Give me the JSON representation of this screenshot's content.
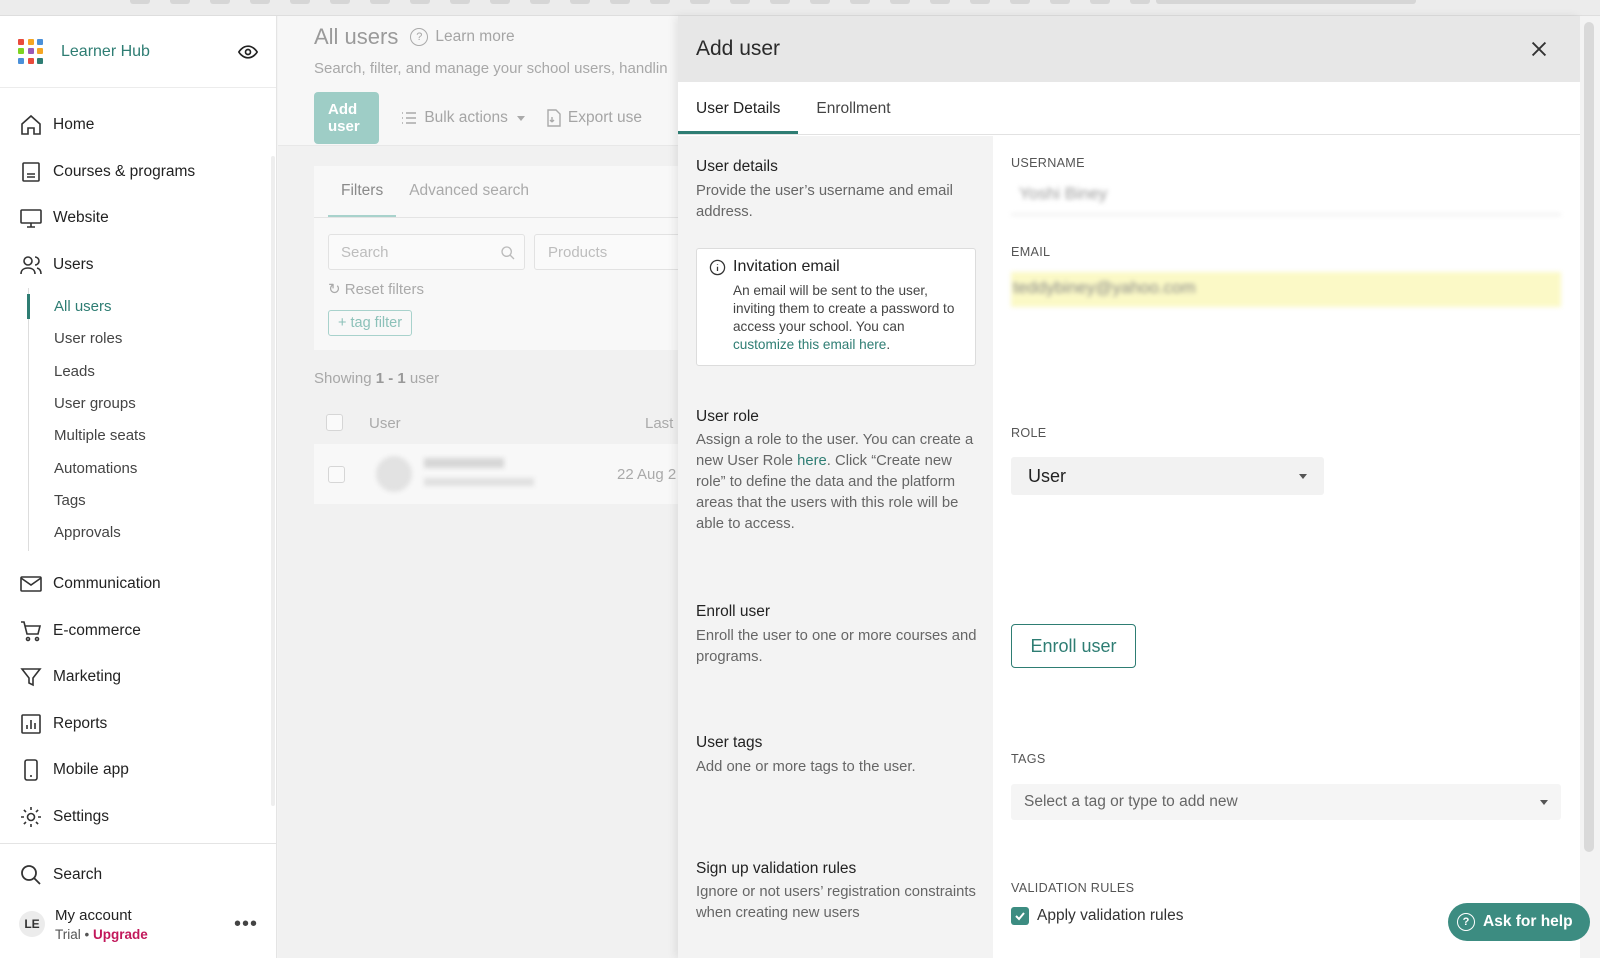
{
  "app": {
    "name": "Learner Hub"
  },
  "sidebar": {
    "nav": [
      {
        "label": "Home",
        "icon": "home-icon"
      },
      {
        "label": "Courses & programs",
        "icon": "courses-icon"
      },
      {
        "label": "Website",
        "icon": "monitor-icon"
      },
      {
        "label": "Users",
        "icon": "users-icon"
      }
    ],
    "users_sub": [
      "All users",
      "User roles",
      "Leads",
      "User groups",
      "Multiple seats",
      "Automations",
      "Tags",
      "Approvals"
    ],
    "nav2": [
      {
        "label": "Communication",
        "icon": "mail-icon"
      },
      {
        "label": "E-commerce",
        "icon": "cart-icon"
      },
      {
        "label": "Marketing",
        "icon": "funnel-icon"
      },
      {
        "label": "Reports",
        "icon": "chart-icon"
      },
      {
        "label": "Mobile app",
        "icon": "phone-icon"
      },
      {
        "label": "Settings",
        "icon": "gear-icon"
      }
    ],
    "search": "Search",
    "account": {
      "initials": "LE",
      "name": "My account",
      "plan": "Trial",
      "upgrade": "Upgrade"
    }
  },
  "main": {
    "title": "All users",
    "learn_more": "Learn more",
    "subtitle": "Search, filter, and manage your school users, handlin",
    "add_user": "Add user",
    "bulk_actions": "Bulk actions",
    "export": "Export use",
    "filter_tabs": [
      "Filters",
      "Advanced search"
    ],
    "search_placeholder": "Search",
    "products_placeholder": "Products",
    "reset_filters": "Reset filters",
    "tag_filter": "+ tag filter",
    "showing_prefix": "Showing",
    "showing_range": "1 - 1",
    "showing_suffix": "user",
    "col_user": "User",
    "col_last": "Last",
    "row_date": "22 Aug 2"
  },
  "modal": {
    "title": "Add user",
    "tabs": [
      "User Details",
      "Enrollment"
    ],
    "sections": {
      "details_title": "User details",
      "details_desc": "Provide the user’s username and email address.",
      "invite_title": "Invitation email",
      "invite_text": "An email will be sent to the user, inviting them to create a password to access your school. You can",
      "invite_link": "customize this email here",
      "role_title": "User role",
      "role_desc_1": "Assign a role to the user. You can create a new User Role",
      "role_link": "here",
      "role_desc_2": ". Click “Create new role” to define the data and the platform areas that the users with this role will be able to access.",
      "enroll_title": "Enroll user",
      "enroll_desc": "Enroll the user to one or more courses and programs.",
      "tags_title": "User tags",
      "tags_desc": "Add one or more tags to the user.",
      "validation_title": "Sign up validation rules",
      "validation_desc": "Ignore or not users’ registration constraints when creating new users"
    },
    "fields": {
      "username_label": "USERNAME",
      "username_value": "Yoshi Biney",
      "email_label": "EMAIL",
      "email_value": "teddybiney@yahoo.com",
      "role_label": "ROLE",
      "role_value": "User",
      "enroll_button": "Enroll user",
      "tags_label": "TAGS",
      "tags_placeholder": "Select a tag or type to add new",
      "validation_label": "VALIDATION RULES",
      "validation_checkbox": "Apply validation rules"
    }
  },
  "help": {
    "label": "Ask for help"
  },
  "colors": {
    "accent": "#2e7d73",
    "upgrade": "#c2185b",
    "email_highlight": "#fbf9c6"
  }
}
